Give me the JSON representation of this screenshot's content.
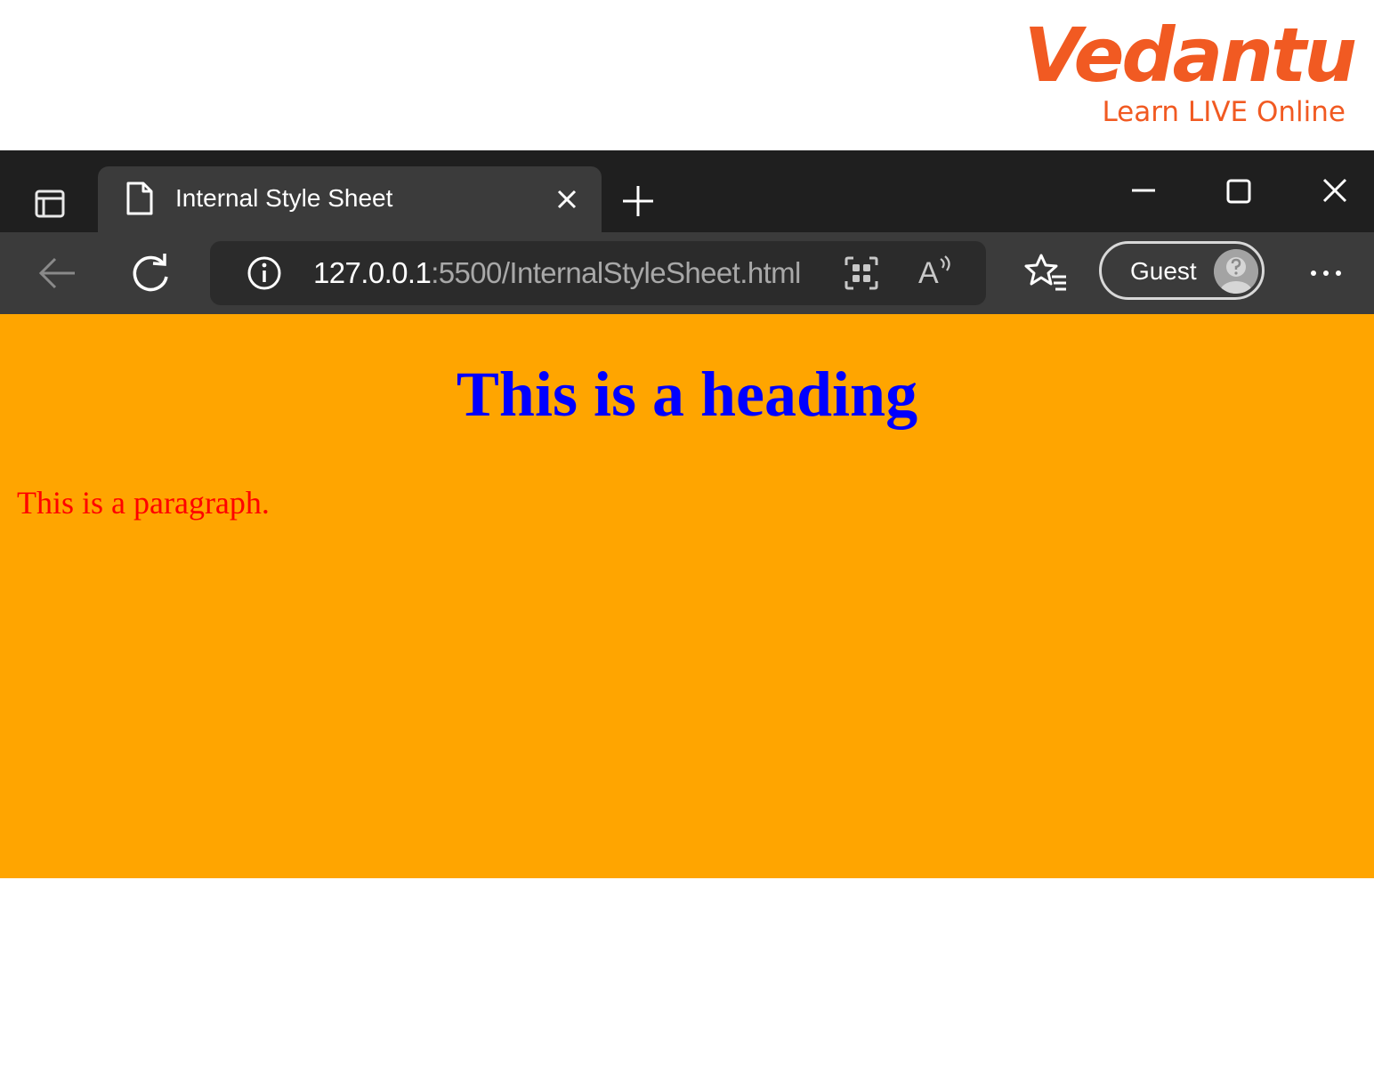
{
  "brand": {
    "logo_text": "Vedantu",
    "tagline": "Learn LIVE Online",
    "color": "#f15a22"
  },
  "browser": {
    "tab": {
      "title": "Internal Style Sheet",
      "favicon": "page-icon"
    },
    "address": {
      "host": "127.0.0.1",
      "path": ":5500/InternalStyleSheet.html"
    },
    "read_aloud_glyph": "A",
    "profile": {
      "label": "Guest",
      "avatar": "guest-avatar-icon"
    },
    "icons": [
      "tab-actions-icon",
      "page-icon",
      "close-icon",
      "plus-icon",
      "minimize-icon",
      "maximize-icon",
      "window-close-icon",
      "back-arrow-icon",
      "reload-icon",
      "info-icon",
      "app-grid-icon",
      "read-aloud-icon",
      "favorites-icon",
      "guest-avatar-icon",
      "more-icon"
    ]
  },
  "page": {
    "background": "#ffa500",
    "heading": {
      "text": "This is a heading",
      "color": "#0000ff"
    },
    "paragraph": {
      "text": "This is a paragraph.",
      "color": "#ff0000"
    }
  }
}
